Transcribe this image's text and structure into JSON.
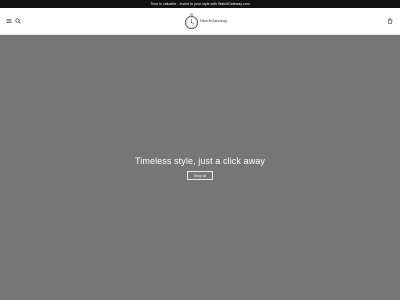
{
  "announcement": {
    "text": "Time is valuable - invest in your style with WatchGateway.com"
  },
  "header": {
    "menu_icon": "menu-icon",
    "search_icon": "search-icon",
    "cart_icon": "cart-icon",
    "logo_text": "WatchGateway"
  },
  "hero": {
    "title": "Timeless style, just a click away",
    "button_label": "Shop all",
    "background_color": "#767676"
  }
}
